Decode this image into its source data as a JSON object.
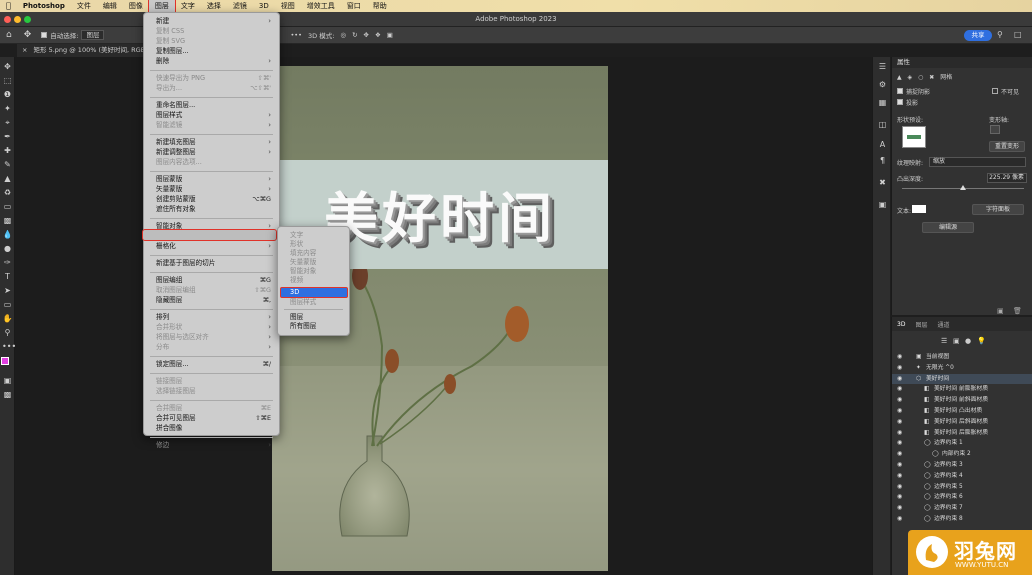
{
  "menubar": {
    "items": [
      "Photoshop",
      "文件",
      "编辑",
      "图像",
      "图层",
      "文字",
      "选择",
      "滤镜",
      "3D",
      "视图",
      "增效工具",
      "窗口",
      "帮助"
    ],
    "active": "图层"
  },
  "window": {
    "title": "Adobe Photoshop 2023"
  },
  "options_bar": {
    "auto_select_label": "自动选择:",
    "auto_select_value": "图层",
    "mode_3d_label": "3D 模式:",
    "share_label": "共享"
  },
  "document_tab": {
    "label": "矩形 5.png @ 100% (美好时间, RGB/8"
  },
  "canvas": {
    "headline": "美好时间"
  },
  "layer_menu": {
    "items": [
      {
        "label": "新建",
        "shortcut": "",
        "submenu": true,
        "disabled": false
      },
      {
        "label": "复制 CSS",
        "shortcut": "",
        "submenu": false,
        "disabled": true
      },
      {
        "label": "复制 SVG",
        "shortcut": "",
        "submenu": false,
        "disabled": true
      },
      {
        "label": "复制图层...",
        "shortcut": "",
        "submenu": false,
        "disabled": false
      },
      {
        "label": "删除",
        "shortcut": "",
        "submenu": true,
        "disabled": false
      },
      {
        "label": "快速导出为 PNG",
        "shortcut": "⇧⌘'",
        "submenu": false,
        "disabled": true
      },
      {
        "label": "导出为...",
        "shortcut": "⌥⇧⌘'",
        "submenu": false,
        "disabled": true
      },
      {
        "label": "重命名图层...",
        "shortcut": "",
        "submenu": false,
        "disabled": false
      },
      {
        "label": "图层样式",
        "shortcut": "",
        "submenu": true,
        "disabled": false
      },
      {
        "label": "智能滤镜",
        "shortcut": "",
        "submenu": true,
        "disabled": true
      },
      {
        "label": "新建填充图层",
        "shortcut": "",
        "submenu": true,
        "disabled": false
      },
      {
        "label": "新建调整图层",
        "shortcut": "",
        "submenu": true,
        "disabled": false
      },
      {
        "label": "图层内容选项...",
        "shortcut": "",
        "submenu": false,
        "disabled": true
      },
      {
        "label": "图层蒙版",
        "shortcut": "",
        "submenu": true,
        "disabled": false
      },
      {
        "label": "矢量蒙版",
        "shortcut": "",
        "submenu": true,
        "disabled": false
      },
      {
        "label": "创建剪贴蒙版",
        "shortcut": "⌥⌘G",
        "submenu": false,
        "disabled": false
      },
      {
        "label": "遮住所有对象",
        "shortcut": "",
        "submenu": false,
        "disabled": false
      },
      {
        "label": "智能对象",
        "shortcut": "",
        "submenu": true,
        "disabled": false
      },
      {
        "label": "视频图层",
        "shortcut": "",
        "submenu": true,
        "disabled": false
      },
      {
        "label": "栅格化",
        "shortcut": "",
        "submenu": true,
        "disabled": false
      },
      {
        "label": "新建基于图层的切片",
        "shortcut": "",
        "submenu": false,
        "disabled": false
      },
      {
        "label": "图层编组",
        "shortcut": "⌘G",
        "submenu": false,
        "disabled": false
      },
      {
        "label": "取消图层编组",
        "shortcut": "⇧⌘G",
        "submenu": false,
        "disabled": true
      },
      {
        "label": "隐藏图层",
        "shortcut": "⌘,",
        "submenu": false,
        "disabled": false
      },
      {
        "label": "排列",
        "shortcut": "",
        "submenu": true,
        "disabled": false
      },
      {
        "label": "合并形状",
        "shortcut": "",
        "submenu": true,
        "disabled": true
      },
      {
        "label": "将图层与选区对齐",
        "shortcut": "",
        "submenu": true,
        "disabled": true
      },
      {
        "label": "分布",
        "shortcut": "",
        "submenu": true,
        "disabled": true
      },
      {
        "label": "锁定图层...",
        "shortcut": "⌘/",
        "submenu": false,
        "disabled": false
      },
      {
        "label": "链接图层",
        "shortcut": "",
        "submenu": false,
        "disabled": true
      },
      {
        "label": "选择链接图层",
        "shortcut": "",
        "submenu": false,
        "disabled": true
      },
      {
        "label": "合并图层",
        "shortcut": "⌘E",
        "submenu": false,
        "disabled": true
      },
      {
        "label": "合并可见图层",
        "shortcut": "⇧⌘E",
        "submenu": false,
        "disabled": false
      },
      {
        "label": "拼合图像",
        "shortcut": "",
        "submenu": false,
        "disabled": false
      },
      {
        "label": "修边",
        "shortcut": "",
        "submenu": true,
        "disabled": true
      }
    ]
  },
  "rasterize_submenu": {
    "items": [
      {
        "label": "文字",
        "disabled": true
      },
      {
        "label": "形状",
        "disabled": true
      },
      {
        "label": "填充内容",
        "disabled": true
      },
      {
        "label": "矢量蒙版",
        "disabled": true
      },
      {
        "label": "智能对象",
        "disabled": true
      },
      {
        "label": "视频",
        "disabled": true
      },
      {
        "label": "3D",
        "disabled": false,
        "highlighted": true
      },
      {
        "label": "图层样式",
        "disabled": true
      },
      {
        "label": "图层",
        "disabled": false
      },
      {
        "label": "所有图层",
        "disabled": false
      }
    ]
  },
  "properties_panel": {
    "title": "属性",
    "mesh_label": "网格",
    "catch_shadow": "捕捉阴影",
    "invisible": "不可见",
    "cast_shadow": "投影",
    "shape_preset": "形状预设:",
    "deform_axis": "变形轴:",
    "reset_deform": "重置变形",
    "texture_map_label": "纹理映射:",
    "texture_map_value": "缩放",
    "extrusion_depth_label": "凸出深度:",
    "extrusion_depth_value": "225.29 像素",
    "extrusion_depth_fraction": 0.5,
    "text_label": "文本:",
    "char_panel": "字符面板",
    "edit_source": "编辑源"
  },
  "panel_3d": {
    "tabs": [
      "3D",
      "图层",
      "通道"
    ],
    "active_tab": "3D",
    "rows": [
      {
        "label": "当前视图",
        "indent": 0,
        "icon": "camera-icon",
        "selected": false
      },
      {
        "label": "无限光 ^0",
        "indent": 0,
        "icon": "light-icon",
        "selected": false
      },
      {
        "label": "美好时间",
        "indent": 0,
        "icon": "mesh-icon",
        "selected": true
      },
      {
        "label": "美好时间 前膨胀材质",
        "indent": 1,
        "icon": "material-icon",
        "selected": false
      },
      {
        "label": "美好时间 前斜面材质",
        "indent": 1,
        "icon": "material-icon",
        "selected": false
      },
      {
        "label": "美好时间 凸出材质",
        "indent": 1,
        "icon": "material-icon",
        "selected": false
      },
      {
        "label": "美好时间 后斜面材质",
        "indent": 1,
        "icon": "material-icon",
        "selected": false
      },
      {
        "label": "美好时间 后膨胀材质",
        "indent": 1,
        "icon": "material-icon",
        "selected": false
      },
      {
        "label": "边界约束 1",
        "indent": 1,
        "icon": "constraint-icon",
        "selected": false
      },
      {
        "label": "内部约束 2",
        "indent": 2,
        "icon": "constraint-icon",
        "selected": false
      },
      {
        "label": "边界约束 3",
        "indent": 1,
        "icon": "constraint-icon",
        "selected": false
      },
      {
        "label": "边界约束 4",
        "indent": 1,
        "icon": "constraint-icon",
        "selected": false
      },
      {
        "label": "边界约束 5",
        "indent": 1,
        "icon": "constraint-icon",
        "selected": false
      },
      {
        "label": "边界约束 6",
        "indent": 1,
        "icon": "constraint-icon",
        "selected": false
      },
      {
        "label": "边界约束 7",
        "indent": 1,
        "icon": "constraint-icon",
        "selected": false
      },
      {
        "label": "边界约束 8",
        "indent": 1,
        "icon": "constraint-icon",
        "selected": false
      }
    ]
  },
  "watermark": {
    "name": "羽兔网",
    "url": "WWW.YUTU.CN"
  },
  "colors": {
    "accent": "#2f6fe0",
    "highlight_outline": "#e0332a",
    "watermark": "#e8a21c",
    "foreground_swatch": "#e040e0"
  }
}
